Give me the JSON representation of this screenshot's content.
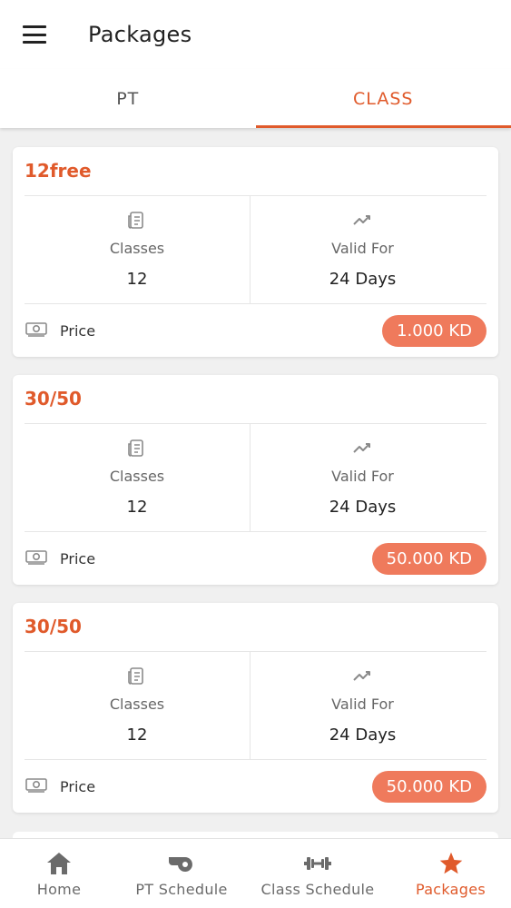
{
  "header": {
    "title": "Packages",
    "menu_icon": "hamburger-menu-icon"
  },
  "tabs": [
    {
      "label": "PT",
      "active": false
    },
    {
      "label": "CLASS",
      "active": true
    }
  ],
  "packages": [
    {
      "title": "12free",
      "classes_label": "Classes",
      "classes": "12",
      "valid_label": "Valid For",
      "valid": "24 Days",
      "price_label": "Price",
      "price": "1.000 KD"
    },
    {
      "title": "30/50",
      "classes_label": "Classes",
      "classes": "12",
      "valid_label": "Valid For",
      "valid": "24 Days",
      "price_label": "Price",
      "price": "50.000 KD"
    },
    {
      "title": "30/50",
      "classes_label": "Classes",
      "classes": "12",
      "valid_label": "Valid For",
      "valid": "24 Days",
      "price_label": "Price",
      "price": "50.000 KD"
    }
  ],
  "bottom_nav": [
    {
      "label": "Home",
      "icon": "home-icon",
      "active": false
    },
    {
      "label": "PT Schedule",
      "icon": "whistle-icon",
      "active": false
    },
    {
      "label": "Class Schedule",
      "icon": "dumbbell-icon",
      "active": false
    },
    {
      "label": "Packages",
      "icon": "star-icon",
      "active": true
    }
  ],
  "colors": {
    "accent": "#e05a2b",
    "price_pill": "#ef7a5c",
    "background": "#f0f0f0"
  }
}
